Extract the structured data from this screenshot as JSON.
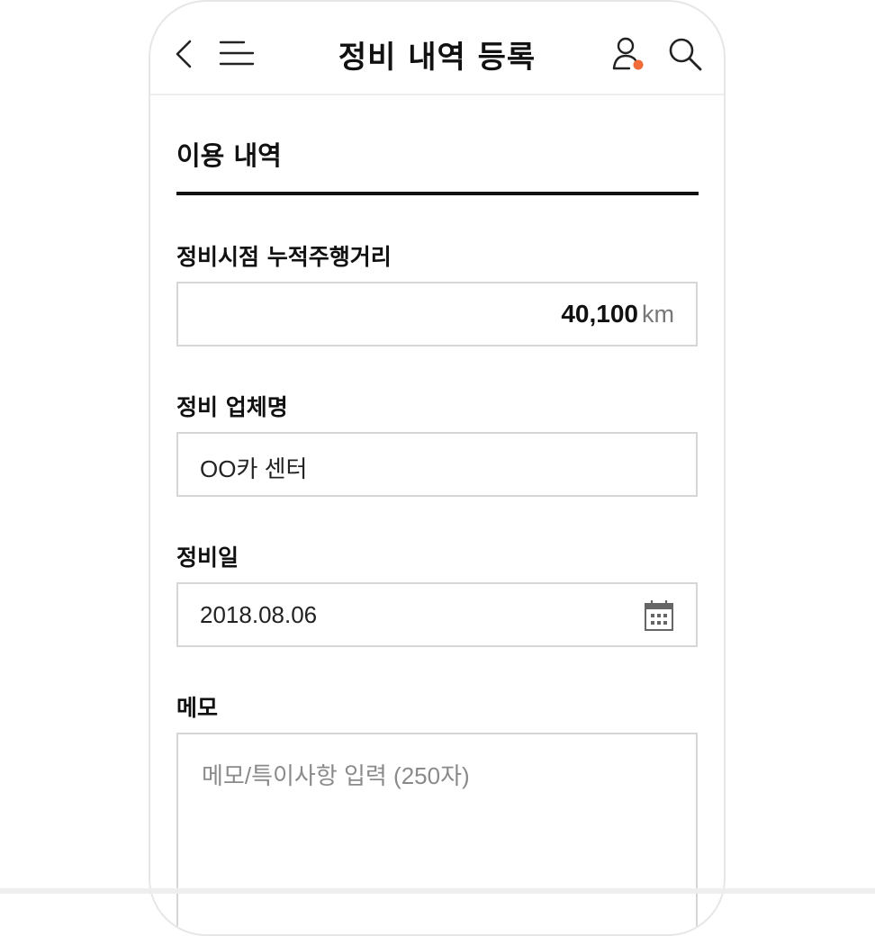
{
  "header": {
    "title": "정비 내역 등록",
    "icons": [
      "back-icon",
      "menu-icon",
      "user-icon",
      "search-icon"
    ],
    "notification_color": "#f26b38"
  },
  "section": {
    "title": "이용 내역"
  },
  "fields": {
    "mileage": {
      "label": "정비시점 누적주행거리",
      "value": "40,100",
      "unit": "km"
    },
    "shop": {
      "label": "정비 업체명",
      "value": "OO카 센터"
    },
    "date": {
      "label": "정비일",
      "value": "2018.08.06",
      "icon": "calendar-icon"
    },
    "memo": {
      "label": "메모",
      "placeholder": "메모/특이사항 입력 (250자)"
    }
  }
}
